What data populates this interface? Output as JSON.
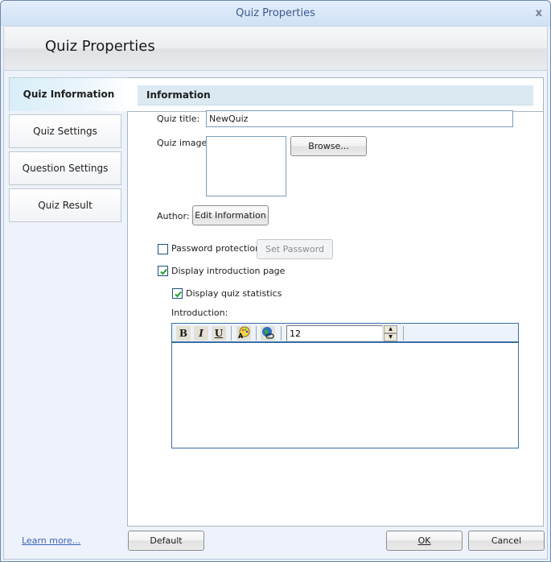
{
  "window": {
    "title": "Quiz Properties",
    "close_glyph": "x",
    "banner_title": "Quiz Properties"
  },
  "sidebar": {
    "items": [
      {
        "label": "Quiz Information",
        "active": true
      },
      {
        "label": "Quiz Settings",
        "active": false
      },
      {
        "label": "Question Settings",
        "active": false
      },
      {
        "label": "Quiz Result",
        "active": false
      }
    ]
  },
  "information": {
    "section_title": "Information",
    "quiz_title_label": "Quiz title:",
    "quiz_title_value": "NewQuiz",
    "quiz_image_label": "Quiz image:",
    "browse_label": "Browse...",
    "author_label": "Author:",
    "edit_information_label": "Edit Information",
    "password_protection_label": "Password protection",
    "password_protection_checked": false,
    "set_password_label": "Set Password",
    "display_intro_label": "Display introduction page",
    "display_intro_checked": true,
    "display_stats_label": "Display quiz statistics",
    "display_stats_checked": true,
    "introduction_label": "Introduction:"
  },
  "editor": {
    "bold_label": "B",
    "italic_label": "I",
    "underline_label": "U",
    "font_size_value": "12",
    "icons": [
      "bold-icon",
      "italic-icon",
      "underline-icon",
      "font-color-icon",
      "hyperlink-icon",
      "spin-up-icon",
      "spin-down-icon"
    ],
    "content": ""
  },
  "footer": {
    "learn_more_label": "Learn more...",
    "default_label": "Default",
    "ok_label": "OK",
    "cancel_label": "Cancel"
  }
}
